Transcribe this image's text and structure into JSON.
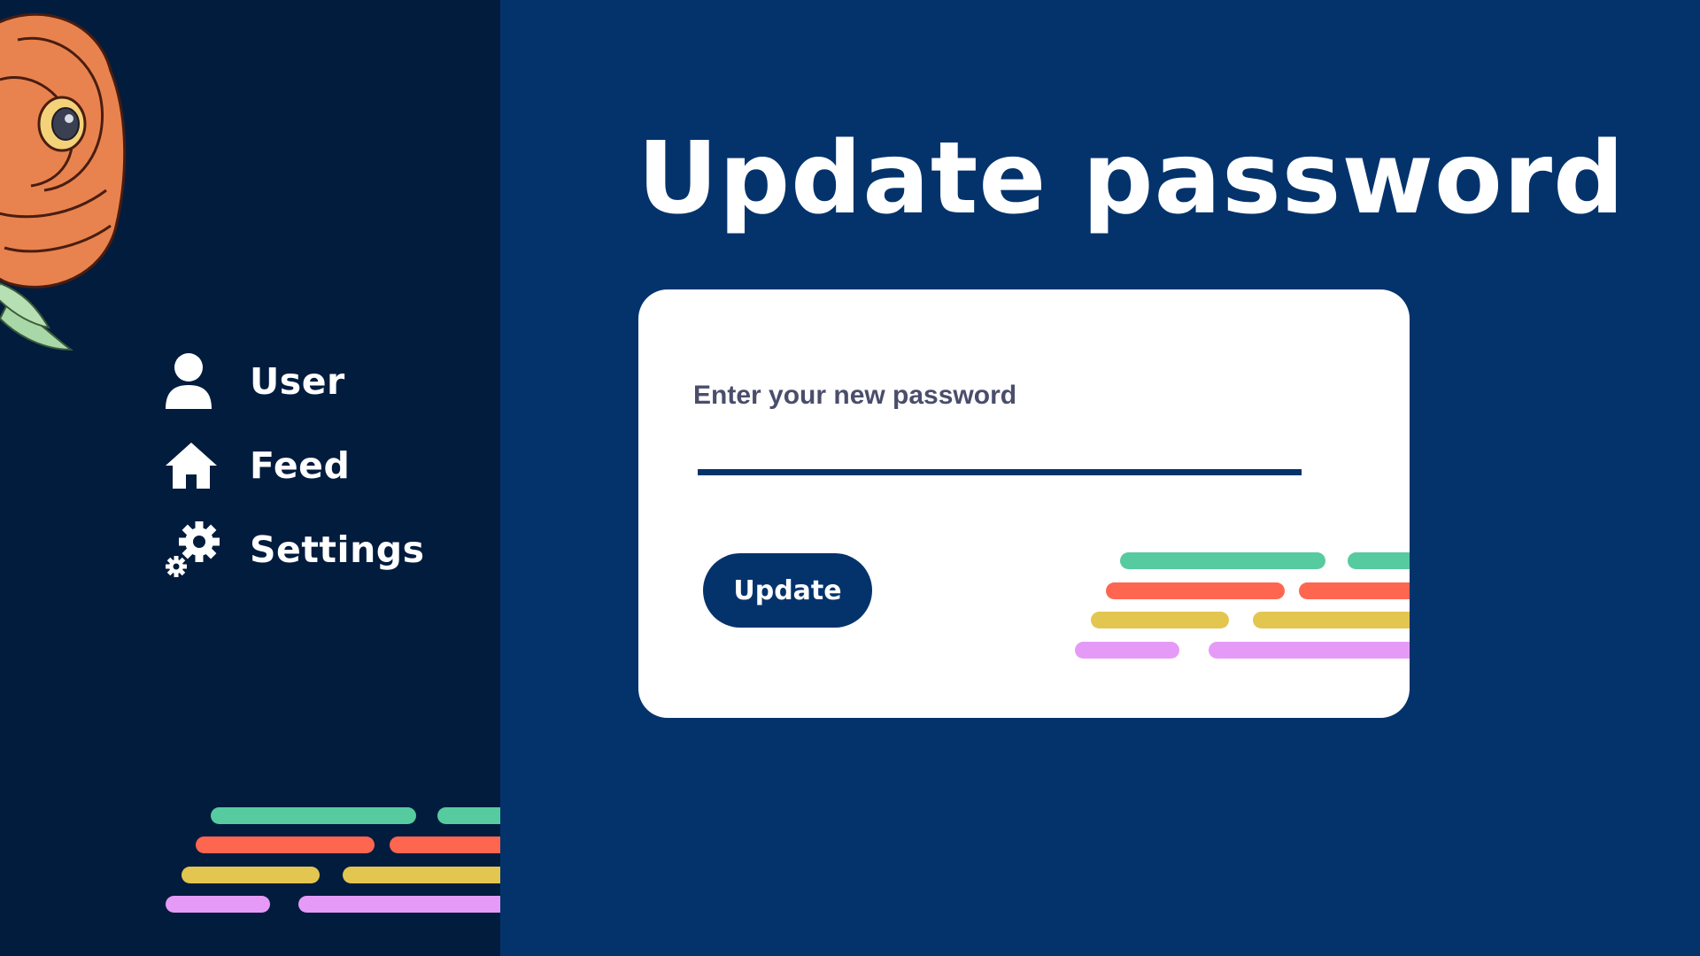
{
  "sidebar": {
    "items": [
      {
        "label": "User",
        "icon": "user-icon"
      },
      {
        "label": "Feed",
        "icon": "home-icon"
      },
      {
        "label": "Settings",
        "icon": "gears-icon"
      }
    ]
  },
  "main": {
    "title": "Update password",
    "form": {
      "field_label": "Enter your new password",
      "password_value": "",
      "button_label": "Update"
    }
  },
  "colors": {
    "sidebar_bg": "#021c3e",
    "main_bg": "#04336c",
    "card_bg": "#ffffff",
    "accent_green": "#56cb9f",
    "accent_red": "#fe6650",
    "accent_yellow": "#e3c650",
    "accent_pink": "#e69af7"
  }
}
